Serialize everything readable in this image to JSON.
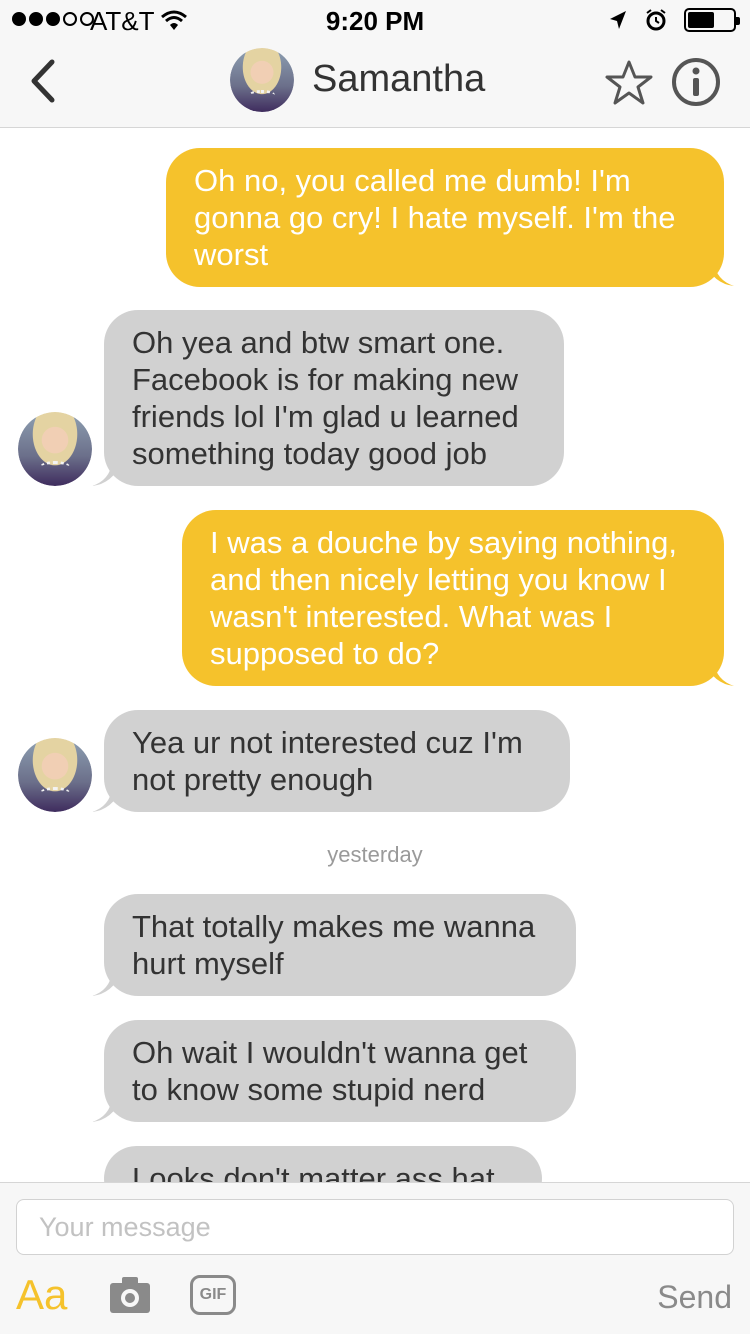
{
  "status_bar": {
    "carrier": "AT&T",
    "time": "9:20 PM",
    "signal_bars": 3,
    "signal_total": 5,
    "battery_level": 0.6
  },
  "header": {
    "title": "Samantha",
    "icons": [
      "back-chevron-icon",
      "avatar",
      "star-icon",
      "info-icon"
    ]
  },
  "messages": [
    {
      "from": "me",
      "text": "Oh no, you called me dumb! I'm gonna go cry! I hate myself. I'm the worst"
    },
    {
      "from": "them",
      "text": "Oh yea and btw smart one. Facebook is for making new friends lol I'm glad u learned something today good job"
    },
    {
      "from": "me",
      "text": "I was a douche by saying nothing, and then nicely letting you know I wasn't interested. What was I supposed to do?"
    },
    {
      "from": "them",
      "text": "Yea ur not interested cuz I'm not pretty enough"
    },
    {
      "from": "them",
      "text": "That totally makes me wanna hurt myself"
    },
    {
      "from": "them",
      "text": "Oh wait I wouldn't wanna get to know some stupid nerd"
    },
    {
      "from": "them",
      "text": "Looks don't matter ass hat"
    }
  ],
  "timestamp_divider": "yesterday",
  "composer": {
    "placeholder": "Your message",
    "font_button": "Aa",
    "gif_label": "GIF",
    "send_label": "Send"
  },
  "colors": {
    "outgoing_bubble": "#f5c22c",
    "incoming_bubble": "#d1d1d1",
    "accent": "#f5c22c"
  }
}
